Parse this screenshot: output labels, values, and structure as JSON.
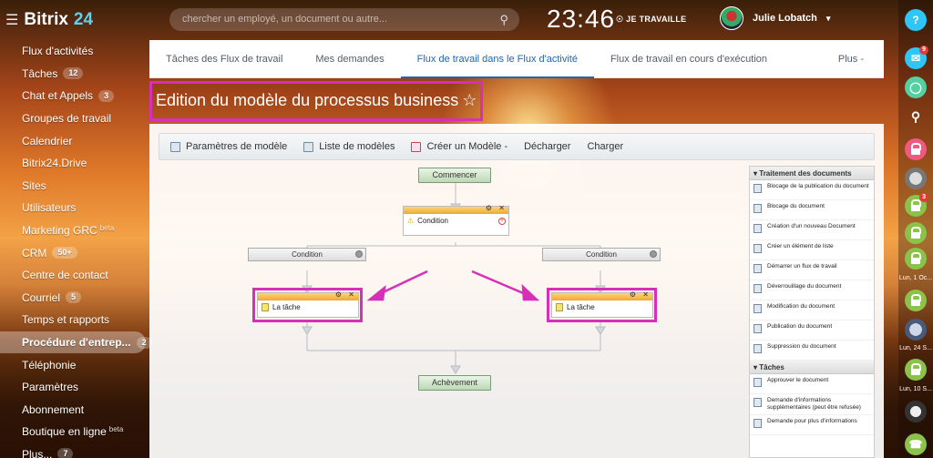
{
  "header": {
    "logo_main": "Bitrix",
    "logo_accent": "24",
    "search_placeholder": "chercher un employé, un document ou autre...",
    "clock": "23:46",
    "work_status": "JE TRAVAILLE",
    "user_name": "Julie Lobatch"
  },
  "sidebar": {
    "items": [
      {
        "label": "Flux d'activités"
      },
      {
        "label": "Tâches",
        "badge": "12"
      },
      {
        "label": "Chat et Appels",
        "badge": "3"
      },
      {
        "label": "Groupes de travail"
      },
      {
        "label": "Calendrier"
      },
      {
        "label": "Bitrix24.Drive"
      },
      {
        "label": "Sites"
      },
      {
        "label": "Utilisateurs"
      },
      {
        "label": "Marketing GRC",
        "sup": "beta"
      },
      {
        "label": "CRM",
        "badge": "50+"
      },
      {
        "label": "Centre de contact"
      },
      {
        "label": "Courriel",
        "badge": "5"
      },
      {
        "label": "Temps et rapports"
      },
      {
        "label": "Procédure d'entrep...",
        "badge": "2",
        "active": true
      },
      {
        "label": "Téléphonie"
      },
      {
        "label": "Paramètres"
      },
      {
        "label": "Abonnement"
      },
      {
        "label": "Boutique en ligne",
        "sup": "beta"
      },
      {
        "label": "Plus...",
        "badge": "7"
      }
    ]
  },
  "tabs": [
    {
      "label": "Tâches des Flux de travail"
    },
    {
      "label": "Mes demandes"
    },
    {
      "label": "Flux de travail dans le Flux d'activité",
      "active": true
    },
    {
      "label": "Flux de travail en cours d'exécution"
    },
    {
      "label": "Plus -"
    }
  ],
  "page": {
    "title": "Edition du modèle du processus business",
    "star": "☆"
  },
  "toolbar": {
    "params": "Paramètres de modèle",
    "list": "Liste de modèles",
    "create": "Créer un Modèle -",
    "unload": "Décharger",
    "load": "Charger"
  },
  "designer": {
    "start": "Commencer",
    "condition_block": "Condition",
    "branch_left": "Condition",
    "branch_right": "Condition",
    "task_left": "La tâche",
    "task_right": "La tâche",
    "end": "Achèvement"
  },
  "activities": {
    "group1_title": "Traitement des documents",
    "group1": [
      "Blocage de la publication du document",
      "Blocage du document",
      "Création d'un nouveau Document",
      "Créer un élément de liste",
      "Démarrer un flux de travail",
      "Déverrouillage du document",
      "Modification du document",
      "Publication du document",
      "Suppression du document"
    ],
    "group2_title": "Tâches",
    "group2": [
      "Approuver le document",
      "Demande d'informations supplémentaires (peut être refusée)",
      "Demande pour plus d'informations"
    ]
  },
  "rightbar": {
    "help": "?",
    "notif_badge": "9",
    "lock_badge": "3",
    "label1": "Lun, 1 Oc...",
    "label2": "Lun, 24 S...",
    "label3": "Lun, 10 S..."
  },
  "colors": {
    "highlight": "#d630b8",
    "active_tab": "#2067b0",
    "accent": "#5fd0ef"
  }
}
